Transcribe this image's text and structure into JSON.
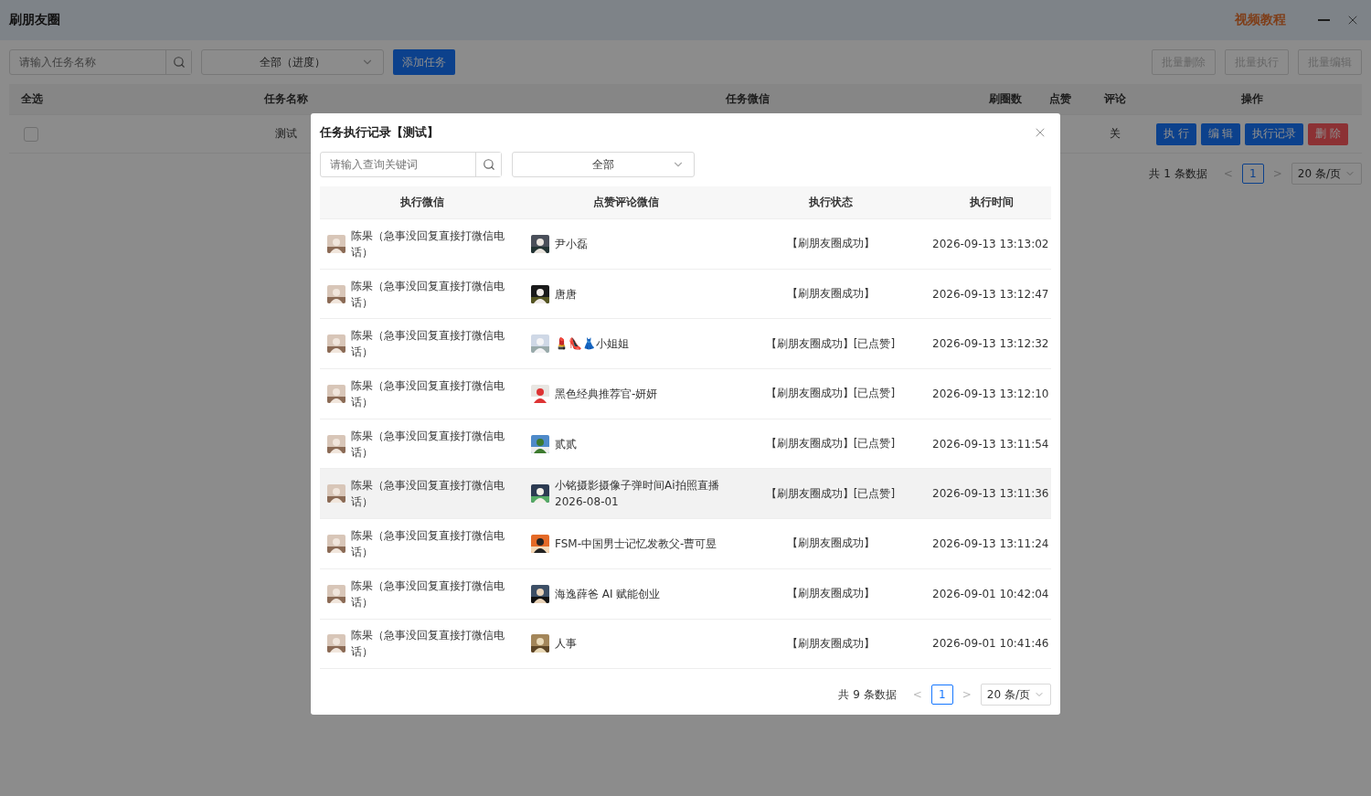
{
  "window": {
    "title": "刷朋友圈",
    "tutorial_link": "视频教程"
  },
  "toolbar": {
    "search_placeholder": "请输入任务名称",
    "filter": "全部（进度）",
    "add_button": "添加任务",
    "batch_buttons": [
      {
        "label": "批量删除",
        "disabled": true
      },
      {
        "label": "批量执行",
        "disabled": true
      },
      {
        "label": "批量编辑",
        "disabled": true
      }
    ]
  },
  "task_table": {
    "columns": [
      "全选",
      "任务名称",
      "任务微信",
      "刷圈数",
      "点赞",
      "评论",
      "操作"
    ],
    "rows": [
      {
        "checked": false,
        "name": "测试",
        "comment": "关",
        "actions": [
          {
            "label": "执 行",
            "kind": "primary"
          },
          {
            "label": "编 辑",
            "kind": "primary"
          },
          {
            "label": "执行记录",
            "kind": "primary"
          },
          {
            "label": "删 除",
            "kind": "danger"
          }
        ]
      }
    ]
  },
  "pagination": {
    "total": "共 1 条数据",
    "prev": "<",
    "next": ">",
    "pages": [
      {
        "label": "1",
        "selected": true
      }
    ],
    "page_size": "20 条/页"
  },
  "dialog": {
    "title": "任务执行记录【测试】",
    "search_placeholder": "请输入查询关键词",
    "filter": "全部",
    "columns": [
      "执行微信",
      "点赞评论微信",
      "执行状态",
      "执行时间"
    ],
    "rows": [
      {
        "executor": "陈果（急事没回复直接打微信电话）",
        "target": "尹小磊",
        "status": "【刷朋友圈成功】",
        "time": "2026-09-13 13:13:02",
        "highlighted": false
      },
      {
        "executor": "陈果（急事没回复直接打微信电话）",
        "target": "唐唐",
        "status": "【刷朋友圈成功】",
        "time": "2026-09-13 13:12:47",
        "highlighted": false
      },
      {
        "executor": "陈果（急事没回复直接打微信电话）",
        "target": "💄👠👗小姐姐",
        "status": "【刷朋友圈成功】[已点赞]",
        "time": "2026-09-13 13:12:32",
        "highlighted": false
      },
      {
        "executor": "陈果（急事没回复直接打微信电话）",
        "target": "黑色经典推荐官-妍妍",
        "status": "【刷朋友圈成功】[已点赞]",
        "time": "2026-09-13 13:12:10",
        "highlighted": false
      },
      {
        "executor": "陈果（急事没回复直接打微信电话）",
        "target": "贰贰",
        "status": "【刷朋友圈成功】[已点赞]",
        "time": "2026-09-13 13:11:54",
        "highlighted": false
      },
      {
        "executor": "陈果（急事没回复直接打微信电话）",
        "target": "小铭摄影摄像子弹时间Ai拍照直播 2026-08-01",
        "status": "【刷朋友圈成功】[已点赞]",
        "time": "2026-09-13 13:11:36",
        "highlighted": true
      },
      {
        "executor": "陈果（急事没回复直接打微信电话）",
        "target": "FSM-中国男士记忆发教父-曹可昱",
        "status": "【刷朋友圈成功】",
        "time": "2026-09-13 13:11:24",
        "highlighted": false
      },
      {
        "executor": "陈果（急事没回复直接打微信电话）",
        "target": "海逸薛爸 AI 赋能创业",
        "status": "【刷朋友圈成功】",
        "time": "2026-09-01 10:42:04",
        "highlighted": false
      },
      {
        "executor": "陈果（急事没回复直接打微信电话）",
        "target": "人事",
        "status": "【刷朋友圈成功】",
        "time": "2026-09-01 10:41:46",
        "highlighted": false
      }
    ],
    "pagination": {
      "total": "共 9 条数据",
      "prev": "<",
      "next": ">",
      "pages": [
        {
          "label": "1",
          "selected": true
        }
      ],
      "page_size": "20 条/页"
    }
  }
}
